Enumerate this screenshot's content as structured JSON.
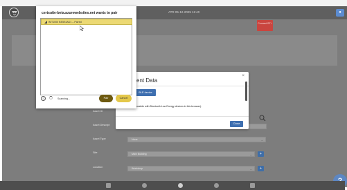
{
  "app": {
    "device_title": "ATR 05-12-2025 11:40",
    "connect_button": "Connect BT+",
    "colors": {
      "connect": "#c9453f",
      "accent": "#3e6fb0",
      "help": "#5d87c3"
    }
  },
  "form": {
    "labels": [
      "Asset ID",
      "Asset Descript",
      "Asset Type",
      "Site",
      "Location"
    ],
    "asset_type_value": "None",
    "site_value": "Main Building",
    "location_value": "Workshop"
  },
  "modal": {
    "title": "ent Data",
    "ble_button": "BLE device",
    "note": "(Bluetooth only possible with Bluetooth Low Energy devices in this browser).",
    "close_button": "Close"
  },
  "pair": {
    "title": "certsuite-beta.azurewebsites.net wants to pair",
    "device_item": "IMT1000 BE5E4AD1 – Paired",
    "status": "Scanning...",
    "pair_button": "Pair",
    "cancel_button": "Cancel",
    "help_label": "?"
  },
  "help_button": "?",
  "user_icon": "person-icon"
}
